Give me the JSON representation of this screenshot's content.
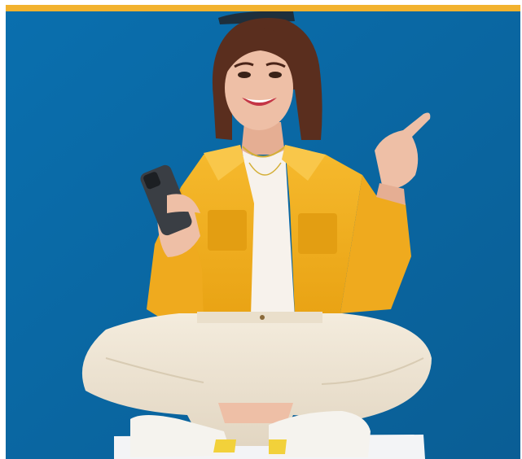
{
  "banner": {
    "accent_bar_color": "#F2B22E",
    "background_color": "#0B6BA6",
    "photo_subject": "smiling-woman-holding-smartphone-pointing-up",
    "palette": {
      "jacket": "#F2B124",
      "trousers": "#EFE6D6",
      "shirt": "#F7F2EC",
      "hair": "#5A2E1E",
      "skin": "#EEBFA6",
      "phone": "#3A3E44",
      "seat": "#F3F4F6"
    }
  }
}
